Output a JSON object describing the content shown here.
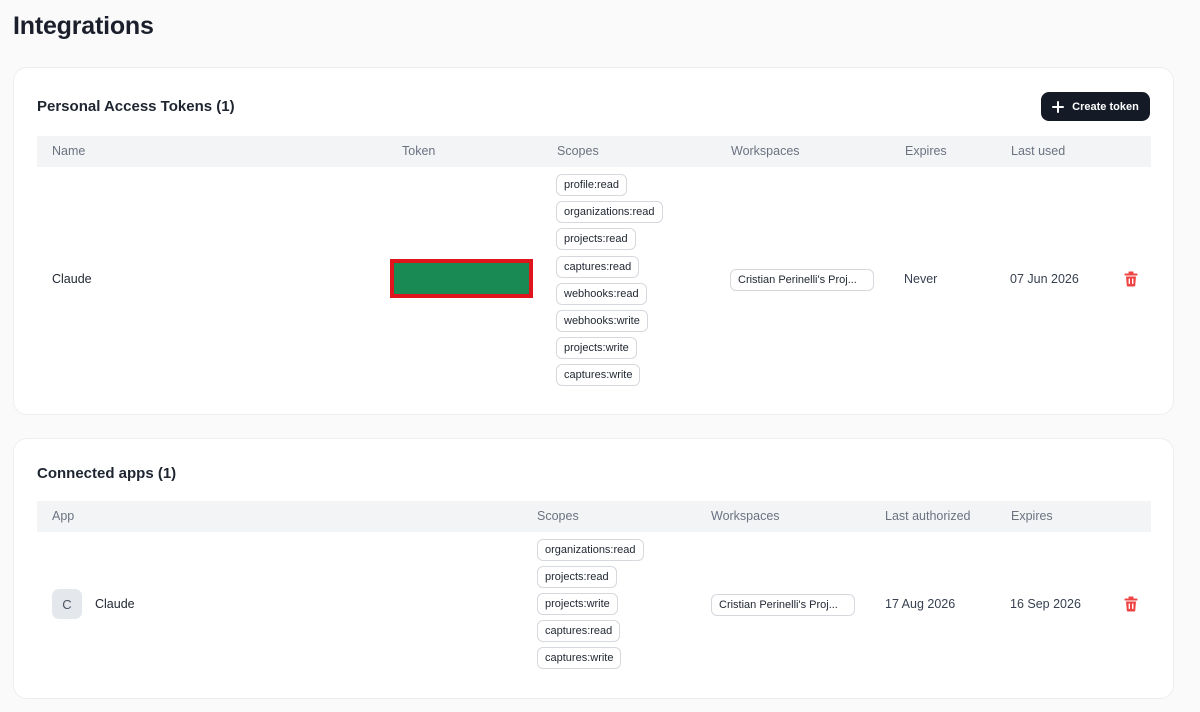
{
  "page": {
    "title": "Integrations"
  },
  "tokens": {
    "title": "Personal Access Tokens (1)",
    "create_label": "Create token",
    "columns": [
      "Name",
      "Token",
      "Scopes",
      "Workspaces",
      "Expires",
      "Last used"
    ],
    "rows": [
      {
        "name": "Claude",
        "scopes": [
          "profile:read",
          "organizations:read",
          "projects:read",
          "captures:read",
          "webhooks:read",
          "webhooks:write",
          "projects:write",
          "captures:write"
        ],
        "workspace": "Cristian Perinelli's Proj...",
        "expires": "Never",
        "last_used": "07 Jun 2026"
      }
    ]
  },
  "apps": {
    "title": "Connected apps (1)",
    "columns": [
      "App",
      "Scopes",
      "Workspaces",
      "Last authorized",
      "Expires"
    ],
    "rows": [
      {
        "avatar": "C",
        "name": "Claude",
        "scopes": [
          "organizations:read",
          "projects:read",
          "projects:write",
          "captures:read",
          "captures:write"
        ],
        "workspace": "Cristian Perinelli's Proj...",
        "last_authorized": "17 Aug 2026",
        "expires": "16 Sep 2026"
      }
    ]
  },
  "colors": {
    "accent_dark": "#141b26",
    "danger": "#ef4444",
    "redaction_fill": "#1a8a55",
    "redaction_border": "#e0141b"
  }
}
